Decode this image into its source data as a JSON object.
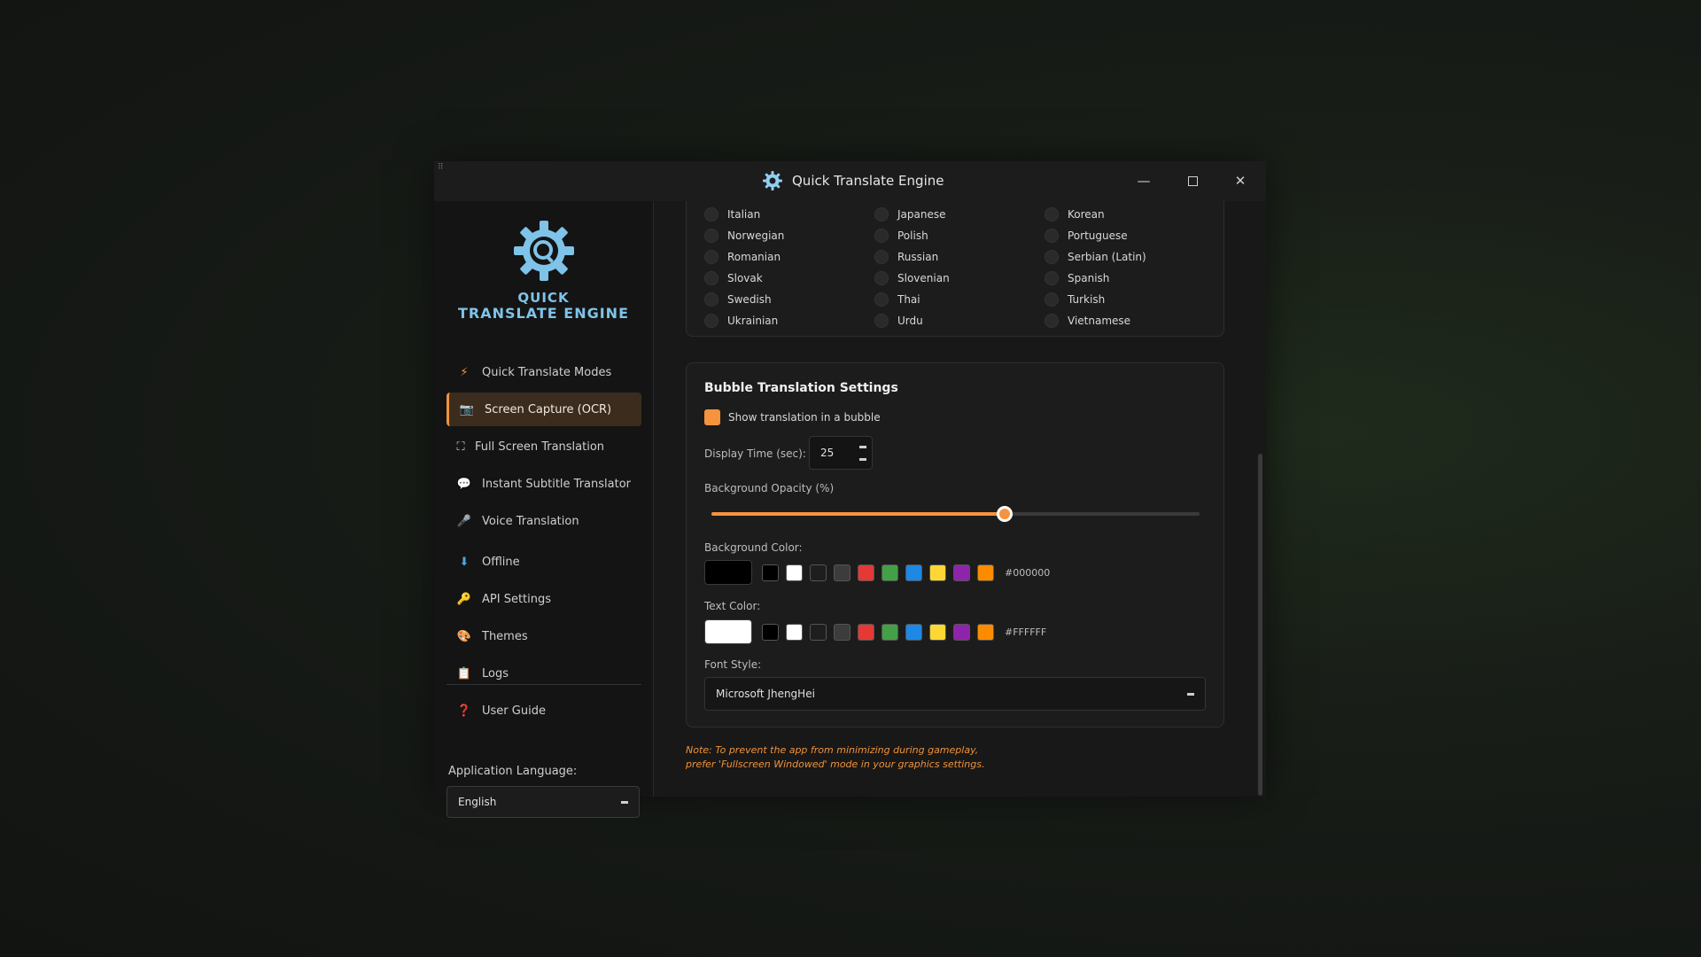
{
  "window": {
    "title": "Quick Translate Engine",
    "grip_icon": "resize-grip-icon"
  },
  "brand": {
    "line1": "QUICK",
    "line2": "TRANSLATE ENGINE",
    "color": "#7fc3e8"
  },
  "sidebar": {
    "items": [
      {
        "label": "Quick Translate Modes",
        "icon": "lightning-icon",
        "glyph": "⚡"
      },
      {
        "label": "Screen Capture (OCR)",
        "icon": "camera-icon",
        "glyph": "📷",
        "active": true
      },
      {
        "label": "Full Screen Translation",
        "icon": "fullscreen-icon",
        "glyph": "⛶"
      },
      {
        "label": "Instant Subtitle Translator",
        "icon": "speech-bubble-icon",
        "glyph": "💬"
      },
      {
        "label": "Voice Translation",
        "icon": "microphone-icon",
        "glyph": "🎤"
      },
      {
        "label": "Offline",
        "icon": "download-icon",
        "glyph": "⬇"
      },
      {
        "label": "API Settings",
        "icon": "key-icon",
        "glyph": "🔑"
      },
      {
        "label": "Themes",
        "icon": "palette-icon",
        "glyph": "🎨"
      },
      {
        "label": "Logs",
        "icon": "log-icon",
        "glyph": "📋"
      },
      {
        "label": "User Guide",
        "icon": "question-icon",
        "glyph": "❓"
      }
    ],
    "language_label": "Application Language:",
    "language_value": "English"
  },
  "languages": {
    "rows": [
      [
        "Italian",
        "Japanese",
        "Korean"
      ],
      [
        "Norwegian",
        "Polish",
        "Portuguese"
      ],
      [
        "Romanian",
        "Russian",
        "Serbian (Latin)"
      ],
      [
        "Slovak",
        "Slovenian",
        "Spanish"
      ],
      [
        "Swedish",
        "Thai",
        "Turkish"
      ],
      [
        "Ukrainian",
        "Urdu",
        "Vietnamese"
      ]
    ]
  },
  "bubble": {
    "title": "Bubble Translation Settings",
    "show_label": "Show translation in a bubble",
    "show_checked": true,
    "display_time_label": "Display Time (sec):",
    "display_time_value": "25",
    "opacity_label": "Background Opacity (%)",
    "opacity_value": 0.6,
    "bg_color_label": "Background Color:",
    "bg_color_value": "#000000",
    "text_color_label": "Text Color:",
    "text_color_value": "#FFFFFF",
    "swatches": [
      "#000000",
      "#ffffff",
      "#1e1e1e",
      "#3c3c3c",
      "#e53935",
      "#43a047",
      "#1e88e5",
      "#fdd835",
      "#8e24aa",
      "#fb8c00"
    ],
    "font_style_label": "Font Style:",
    "font_style_value": "Microsoft JhengHei"
  },
  "note": {
    "line1": "Note: To prevent the app from minimizing during gameplay,",
    "line2": "prefer 'Fullscreen Windowed' mode in your graphics settings."
  },
  "colors": {
    "accent": "#f5933e",
    "active_bg": "#3b2c1d"
  }
}
